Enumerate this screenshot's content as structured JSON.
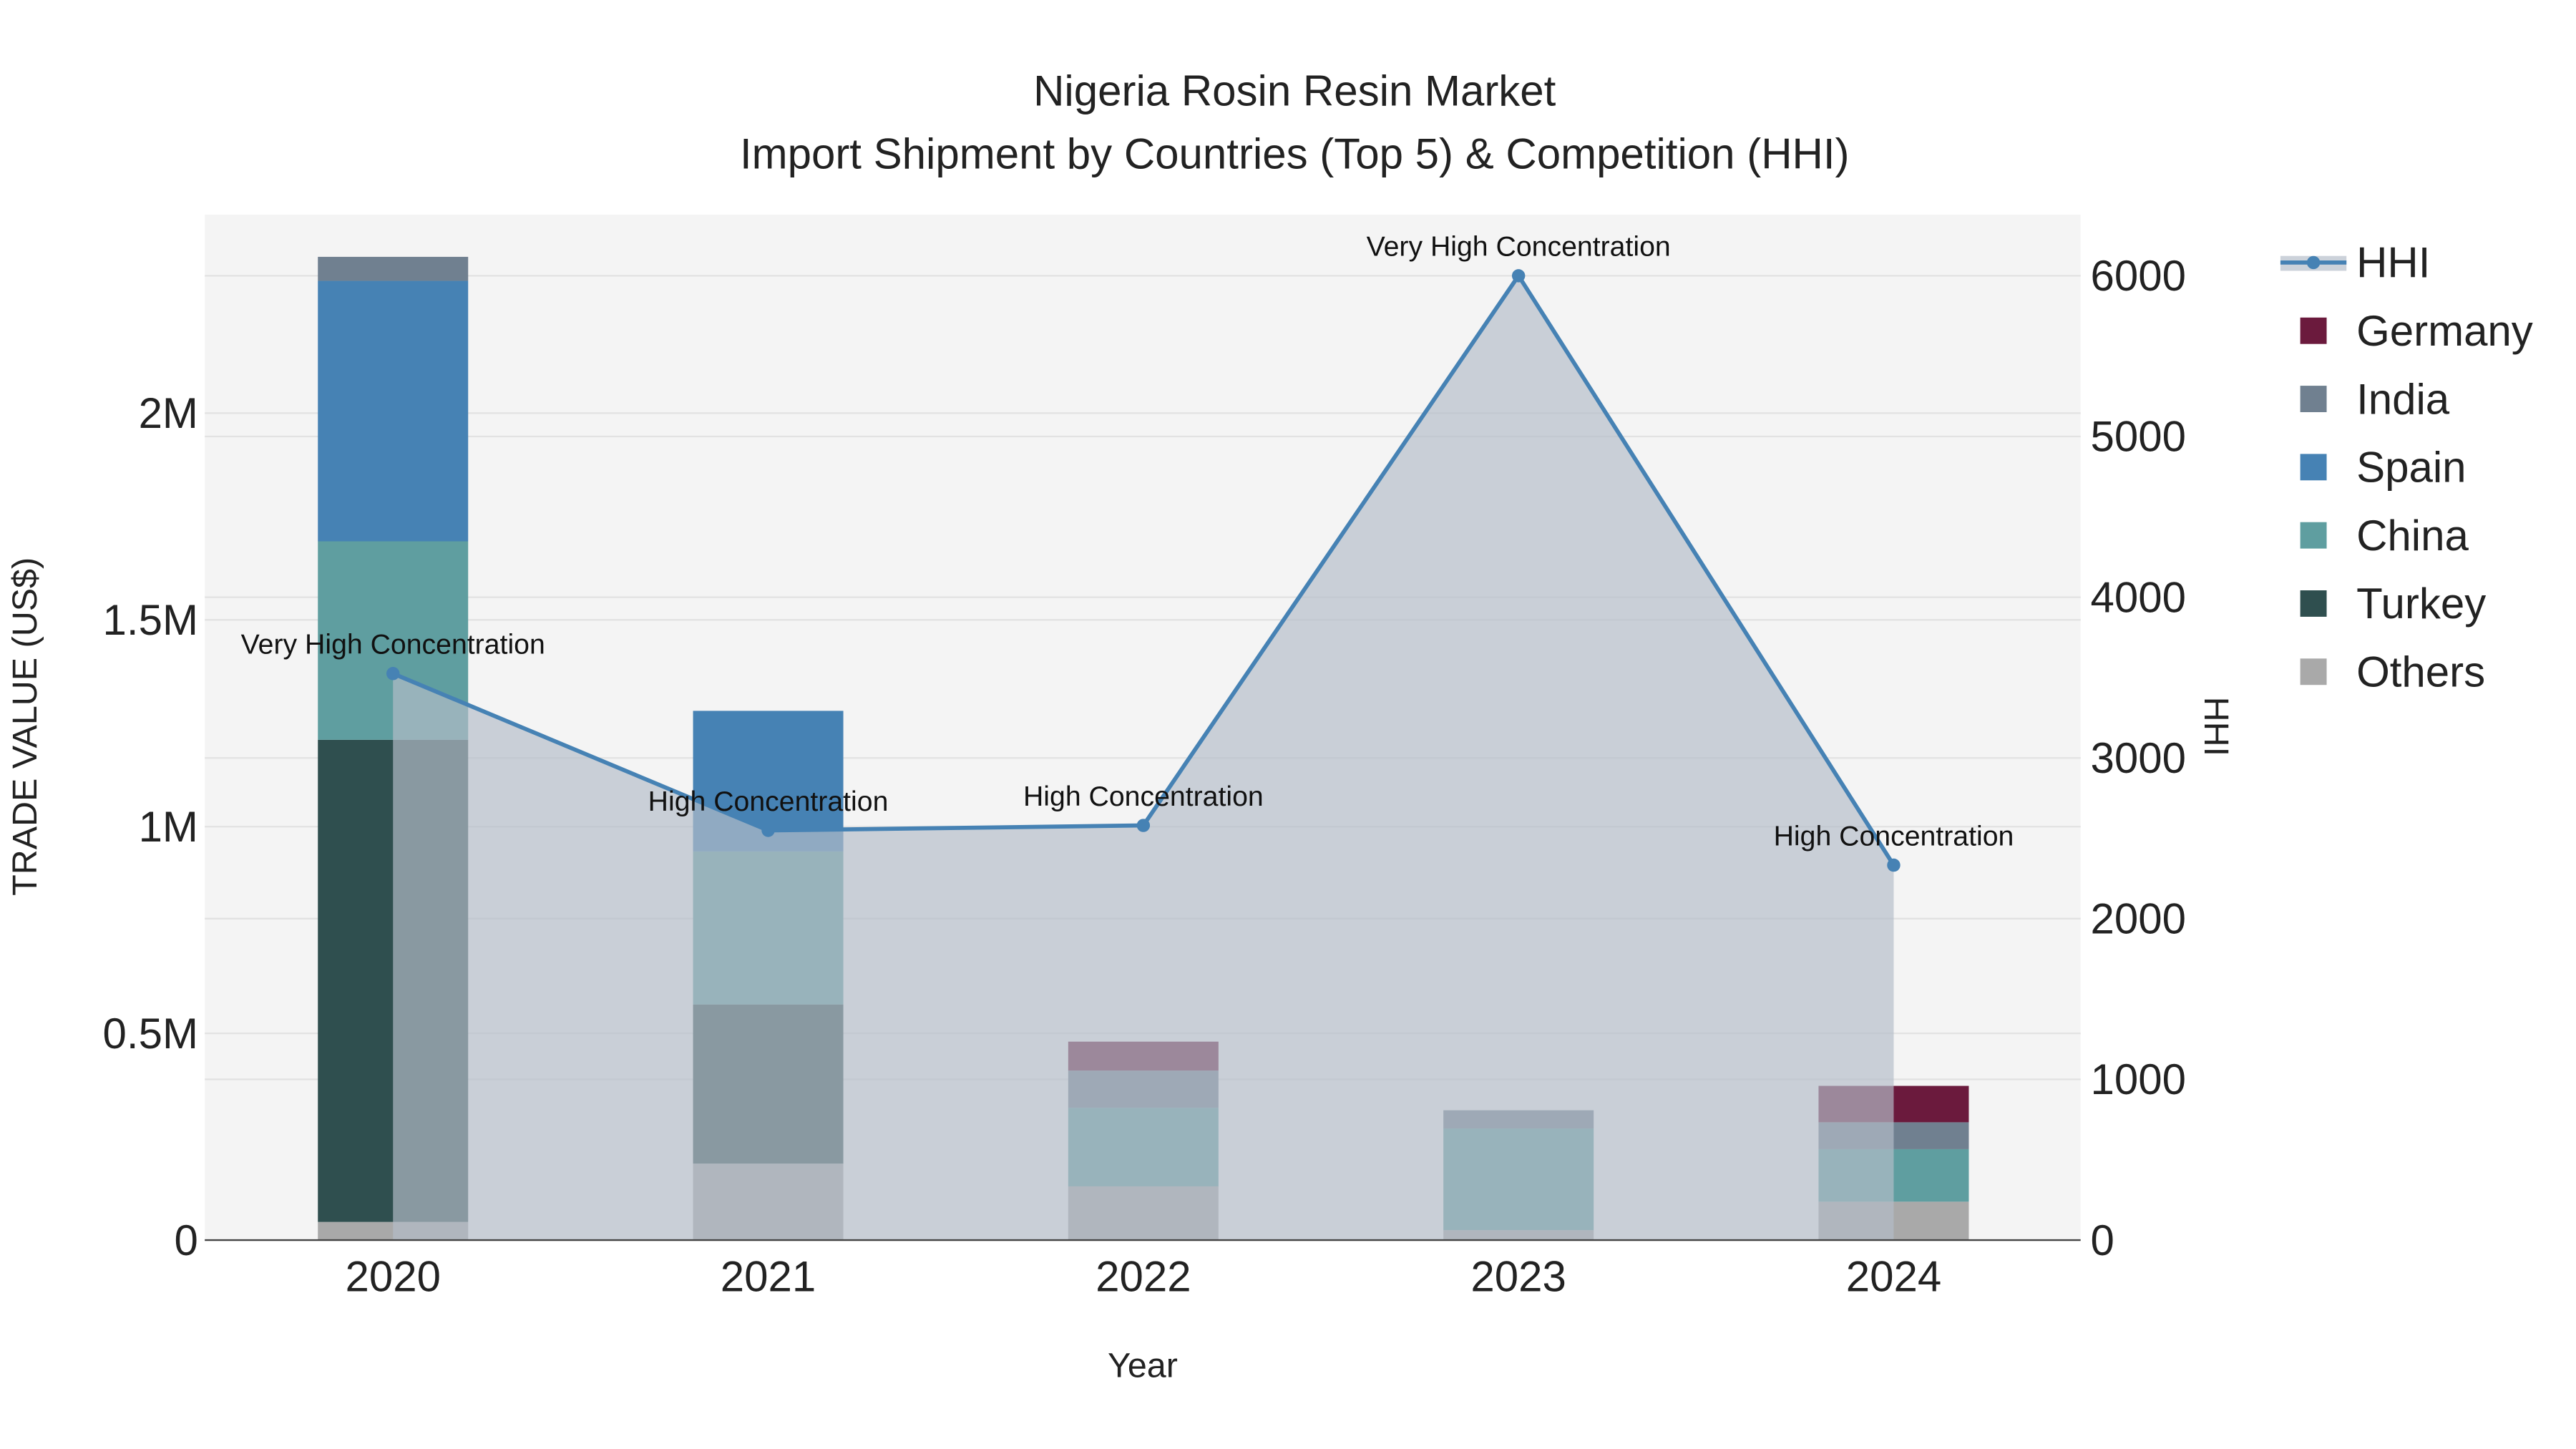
{
  "chart_data": {
    "type": "bar",
    "title": "Nigeria Rosin Resin Market",
    "subtitle": "Import Shipment by Countries (Top 5) & Competition (HHI)",
    "xlabel": "Year",
    "ylabel": "TRADE VALUE (US$)",
    "y2label": "HHI",
    "categories": [
      "2020",
      "2021",
      "2022",
      "2023",
      "2024"
    ],
    "ylim": [
      0,
      2480000
    ],
    "y2lim": [
      0,
      6380
    ],
    "yticks": [
      {
        "v": 0,
        "label": "0"
      },
      {
        "v": 500000,
        "label": "0.5M"
      },
      {
        "v": 1000000,
        "label": "1M"
      },
      {
        "v": 1500000,
        "label": "1.5M"
      },
      {
        "v": 2000000,
        "label": "2M"
      }
    ],
    "y2ticks": [
      {
        "v": 0,
        "label": "0"
      },
      {
        "v": 1000,
        "label": "1000"
      },
      {
        "v": 2000,
        "label": "2000"
      },
      {
        "v": 3000,
        "label": "3000"
      },
      {
        "v": 4000,
        "label": "4000"
      },
      {
        "v": 5000,
        "label": "5000"
      },
      {
        "v": 6000,
        "label": "6000"
      }
    ],
    "series": [
      {
        "name": "Others",
        "color": "#a9a9a9",
        "values": [
          44000,
          185000,
          130000,
          24000,
          93000
        ]
      },
      {
        "name": "Turkey",
        "color": "#2f4f4f",
        "values": [
          1166000,
          385000,
          0,
          0,
          0
        ]
      },
      {
        "name": "China",
        "color": "#5f9ea0",
        "values": [
          480000,
          370000,
          190000,
          246000,
          127000
        ]
      },
      {
        "name": "Spain",
        "color": "#4682b4",
        "values": [
          630000,
          340000,
          0,
          0,
          0
        ]
      },
      {
        "name": "India",
        "color": "#708090",
        "values": [
          58000,
          0,
          90000,
          44000,
          65000
        ]
      },
      {
        "name": "Germany",
        "color": "#6b1a3d",
        "values": [
          0,
          0,
          70000,
          0,
          88000
        ]
      }
    ],
    "hhi": {
      "name": "HHI",
      "color": "#4682b4",
      "values": [
        3525,
        2549,
        2580,
        6000,
        2333
      ],
      "annotations": [
        "Very High Concentration",
        "High Concentration",
        "High Concentration",
        "Very High Concentration",
        "High Concentration"
      ]
    },
    "legend": [
      "HHI",
      "Germany",
      "India",
      "Spain",
      "China",
      "Turkey",
      "Others"
    ],
    "legend_position": "right",
    "grid": true
  }
}
